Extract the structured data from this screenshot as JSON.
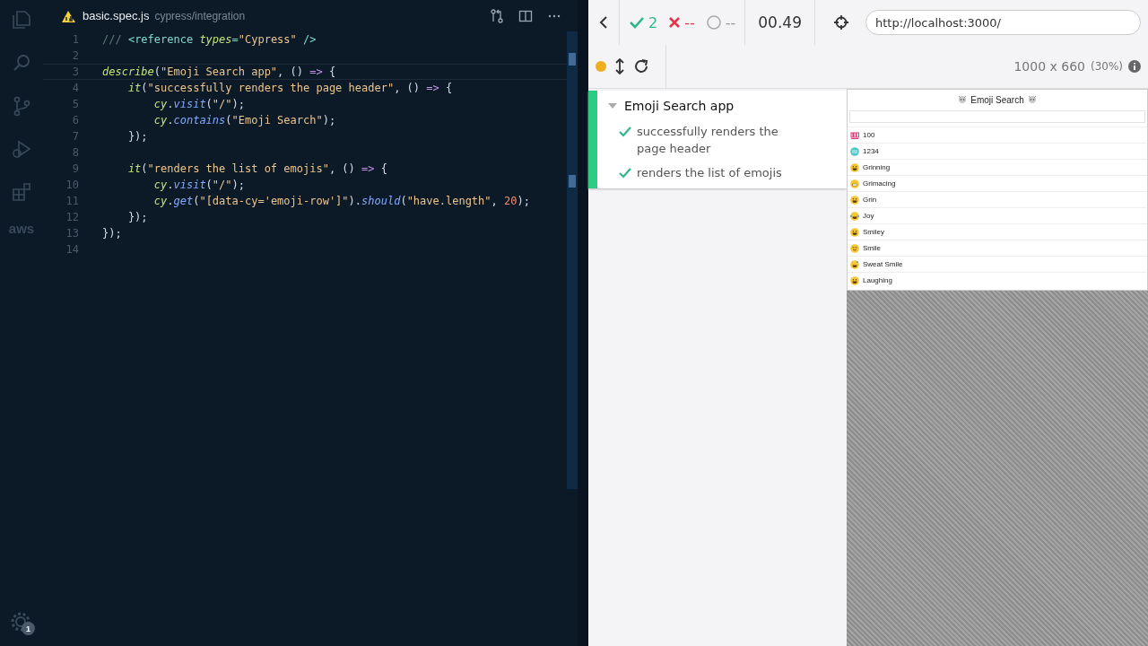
{
  "activity_bar": {
    "items": [
      {
        "kind": "files"
      },
      {
        "kind": "search"
      },
      {
        "kind": "source-control"
      },
      {
        "kind": "debug"
      },
      {
        "kind": "extensions"
      },
      {
        "kind": "aws",
        "label": "aws"
      }
    ],
    "settings_badge": "1"
  },
  "editor": {
    "tab": {
      "filename": "basic.spec.js",
      "path": "cypress/integration"
    },
    "lines": [
      {
        "number": "1",
        "selected": false,
        "tokens": [
          {
            "kind": "comment",
            "text": "///"
          },
          {
            "kind": "tag",
            "text": " <reference"
          },
          {
            "kind": "attr",
            "text": " types"
          },
          {
            "kind": "tag",
            "text": "="
          },
          {
            "kind": "string",
            "text": "\"Cypress\""
          },
          {
            "kind": "tag",
            "text": " />"
          }
        ]
      },
      {
        "number": "2",
        "selected": false
      },
      {
        "number": "3",
        "selected": true,
        "tokens": [
          {
            "kind": "fn",
            "text": "describe"
          },
          {
            "kind": "plain",
            "text": "("
          },
          {
            "kind": "string",
            "text": "\"Emoji Search app\""
          },
          {
            "kind": "plain",
            "text": ", ()"
          },
          {
            "kind": "keyword",
            "text": " =>"
          },
          {
            "kind": "bracket",
            "text": " {"
          }
        ]
      },
      {
        "number": "4",
        "selected": false,
        "tokens": [
          {
            "kind": "fn",
            "text": "    it"
          },
          {
            "kind": "plain",
            "text": "("
          },
          {
            "kind": "string",
            "text": "\"successfully renders the page header\""
          },
          {
            "kind": "plain",
            "text": ", ()"
          },
          {
            "kind": "keyword",
            "text": " =>"
          },
          {
            "kind": "plain",
            "text": " {"
          }
        ]
      },
      {
        "number": "5",
        "selected": false,
        "tokens": [
          {
            "kind": "fn",
            "text": "        cy"
          },
          {
            "kind": "plain",
            "text": "."
          },
          {
            "kind": "method",
            "text": "visit"
          },
          {
            "kind": "plain",
            "text": "("
          },
          {
            "kind": "string",
            "text": "\"/\""
          },
          {
            "kind": "plain",
            "text": ");"
          }
        ]
      },
      {
        "number": "6",
        "selected": false,
        "tokens": [
          {
            "kind": "fn",
            "text": "        cy"
          },
          {
            "kind": "plain",
            "text": "."
          },
          {
            "kind": "method",
            "text": "contains"
          },
          {
            "kind": "plain",
            "text": "("
          },
          {
            "kind": "string",
            "text": "\"Emoji Search\""
          },
          {
            "kind": "plain",
            "text": ");"
          }
        ]
      },
      {
        "number": "7",
        "selected": false,
        "tokens": [
          {
            "kind": "plain",
            "text": "    });"
          }
        ]
      },
      {
        "number": "8",
        "selected": false
      },
      {
        "number": "9",
        "selected": false,
        "tokens": [
          {
            "kind": "fn",
            "text": "    it"
          },
          {
            "kind": "plain",
            "text": "("
          },
          {
            "kind": "string",
            "text": "\"renders the list of emojis\""
          },
          {
            "kind": "plain",
            "text": ", ()"
          },
          {
            "kind": "keyword",
            "text": " =>"
          },
          {
            "kind": "plain",
            "text": " {"
          }
        ]
      },
      {
        "number": "10",
        "selected": false,
        "tokens": [
          {
            "kind": "fn",
            "text": "        cy"
          },
          {
            "kind": "plain",
            "text": "."
          },
          {
            "kind": "method",
            "text": "visit"
          },
          {
            "kind": "plain",
            "text": "("
          },
          {
            "kind": "string",
            "text": "\"/\""
          },
          {
            "kind": "plain",
            "text": ");"
          }
        ]
      },
      {
        "number": "11",
        "selected": false,
        "tokens": [
          {
            "kind": "fn",
            "text": "        cy"
          },
          {
            "kind": "plain",
            "text": "."
          },
          {
            "kind": "method",
            "text": "get"
          },
          {
            "kind": "plain",
            "text": "("
          },
          {
            "kind": "string",
            "text": "\"[data-cy='emoji-row']\""
          },
          {
            "kind": "plain",
            "text": ")."
          },
          {
            "kind": "method",
            "text": "should"
          },
          {
            "kind": "plain",
            "text": "("
          },
          {
            "kind": "string",
            "text": "\"have.length\""
          },
          {
            "kind": "plain",
            "text": ","
          },
          {
            "kind": "number",
            "text": " 20"
          },
          {
            "kind": "plain",
            "text": ");"
          }
        ]
      },
      {
        "number": "12",
        "selected": false,
        "tokens": [
          {
            "kind": "plain",
            "text": "    });"
          }
        ]
      },
      {
        "number": "13",
        "selected": false,
        "tokens": [
          {
            "kind": "bracket",
            "text": "}"
          },
          {
            "kind": "plain",
            "text": ");"
          }
        ]
      },
      {
        "number": "14",
        "selected": false
      }
    ]
  },
  "runner": {
    "stats": {
      "passed": "2",
      "failed": "--",
      "pending": "--",
      "duration": "00.49"
    },
    "url": "http://localhost:3000/",
    "viewport": "1000 x 660",
    "scale": "(30%)",
    "running": true,
    "suite": {
      "title": "Emoji Search app",
      "expanded": true,
      "tests": [
        {
          "title": "successfully renders the page header",
          "passed": true
        },
        {
          "title": "renders the list of emojis",
          "passed": true
        }
      ]
    },
    "app": {
      "title": "Emoji Search",
      "rows": [
        {
          "kind": "hundred",
          "label": "100"
        },
        {
          "kind": "numbers",
          "label": "1234"
        },
        {
          "kind": "grin",
          "label": "Grinning"
        },
        {
          "kind": "grimace",
          "label": "Grimacing"
        },
        {
          "kind": "grin",
          "label": "Grin"
        },
        {
          "kind": "tears",
          "label": "Joy"
        },
        {
          "kind": "grin",
          "label": "Smiley"
        },
        {
          "kind": "smile",
          "label": "Smile"
        },
        {
          "kind": "sweat",
          "label": "Sweat Smile"
        },
        {
          "kind": "grin",
          "label": "Laughing"
        }
      ]
    }
  }
}
